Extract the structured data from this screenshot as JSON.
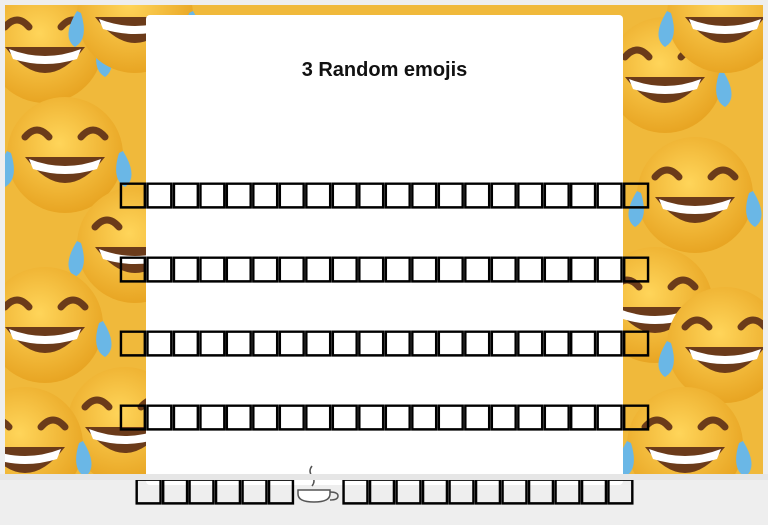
{
  "page": {
    "title": "3 Random emojis"
  },
  "emoji_grid": {
    "rows": [
      "□□□□□□□□□□□□□□□□□□□□",
      "□□□□□□□□□□□□□□□□□□□□",
      "□□□□□□□□□□□□□□□□□□□□",
      "□□□□□□□□□□□□□□□□□□□□"
    ],
    "last_row_left": "□□□□□□",
    "last_row_icon": "hot-beverage-icon",
    "last_row_right": "□□□□□□□□□□□"
  },
  "colors": {
    "card": "#ffffff",
    "emoji_face": "#f5c342",
    "tear": "#6ab7e6"
  }
}
